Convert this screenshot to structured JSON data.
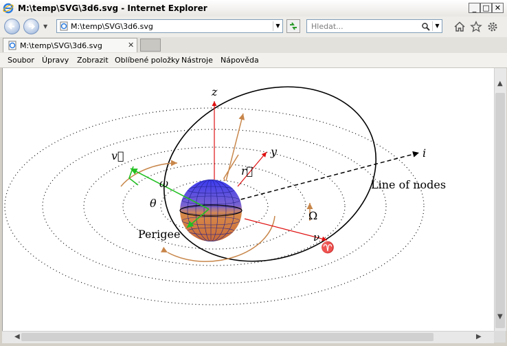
{
  "window": {
    "title": "M:\\temp\\SVG\\3d6.svg - Internet Explorer",
    "minimize_glyph": "_",
    "maximize_glyph": "□",
    "close_glyph": "✕"
  },
  "navigation": {
    "address": "M:\\temp\\SVG\\3d6.svg",
    "search_placeholder": "Hledat...",
    "dropdown_glyph": "▼"
  },
  "tabs": [
    {
      "label": "M:\\temp\\SVG\\3d6.svg",
      "close_glyph": "✕"
    }
  ],
  "menu": [
    "Soubor",
    "Úpravy",
    "Zobrazit",
    "Oblíbené položky",
    "Nástroje",
    "Nápověda"
  ],
  "scroll": {
    "up": "▲",
    "down": "▼",
    "left": "◀",
    "right": "▶"
  },
  "diagram": {
    "labels": {
      "z": "z",
      "y": "y",
      "i": "i",
      "v": "v⃗",
      "r": "r⃗",
      "omega_small": "ω",
      "theta": "θ",
      "perigee": "Perigee",
      "line_of_nodes": "Line of nodes",
      "omega_big": "Ω",
      "nu": "ν",
      "aries": "♈"
    },
    "colors": {
      "axis": "#e01010",
      "velocity": "#22c022",
      "motion": "#c8864a",
      "orbit": "#000000",
      "sphere_top": "#3a3af0",
      "sphere_bottom": "#d88a4a"
    }
  }
}
